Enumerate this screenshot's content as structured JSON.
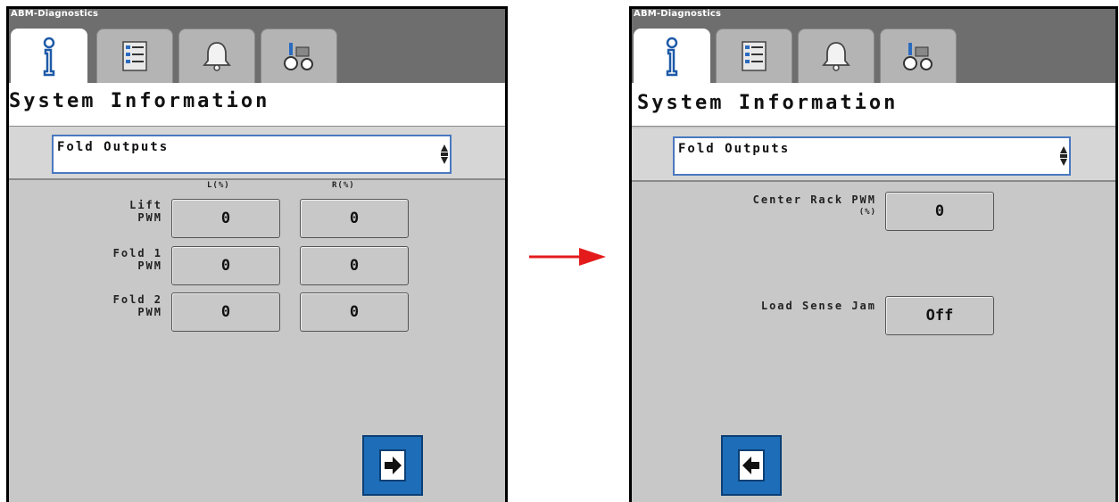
{
  "app_title": "ABM-Diagnostics",
  "tabs": [
    {
      "icon": "info-icon",
      "active": true
    },
    {
      "icon": "checklist-icon",
      "active": false
    },
    {
      "icon": "alarm-bell-icon",
      "active": false
    },
    {
      "icon": "tractor-icon",
      "active": false
    }
  ],
  "left_screen": {
    "page_title": "System Information",
    "dropdown_value": "Fold Outputs",
    "col_left": "L(%)",
    "col_right": "R(%)",
    "rows": [
      {
        "label1": "Lift",
        "label2": "PWM",
        "left": "0",
        "right": "0"
      },
      {
        "label1": "Fold 1",
        "label2": "PWM",
        "left": "0",
        "right": "0"
      },
      {
        "label1": "Fold 2",
        "label2": "PWM",
        "left": "0",
        "right": "0"
      }
    ],
    "next_button_icon": "next-page-icon"
  },
  "right_screen": {
    "page_title": "System Information",
    "dropdown_value": "Fold Outputs",
    "center_rack_label": "Center Rack PWM",
    "center_rack_unit": "(%)",
    "center_rack_value": "0",
    "load_sense_label": "Load Sense Jam",
    "load_sense_value": "Off",
    "prev_button_icon": "previous-page-icon"
  },
  "colors": {
    "accent": "#1e6db8",
    "arrow": "#e41b1b",
    "dropdown_border": "#4a78c0"
  }
}
